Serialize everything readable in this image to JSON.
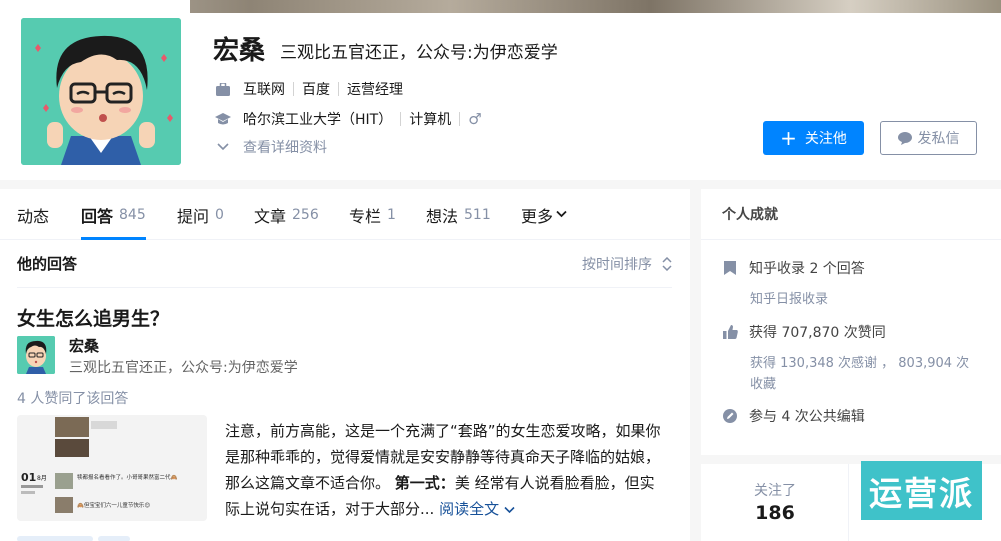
{
  "profile": {
    "name": "宏桑",
    "headline": "三观比五官还正，公众号:为伊恋爱学",
    "work": [
      "互联网",
      "百度",
      "运营经理"
    ],
    "education": [
      "哈尔滨工业大学（HIT）",
      "计算机"
    ],
    "gender_symbol": "♂",
    "more_details": "查看详细资料",
    "follow_label": "关注他",
    "message_label": "发私信"
  },
  "tabs": [
    {
      "label": "动态",
      "count": ""
    },
    {
      "label": "回答",
      "count": "845"
    },
    {
      "label": "提问",
      "count": "0"
    },
    {
      "label": "文章",
      "count": "256"
    },
    {
      "label": "专栏",
      "count": "1"
    },
    {
      "label": "想法",
      "count": "511"
    },
    {
      "label": "更多",
      "count": ""
    }
  ],
  "list": {
    "title": "他的回答",
    "sort": "按时间排序"
  },
  "answer": {
    "question": "女生怎么追男生？",
    "author": "宏桑",
    "author_bio": "三观比五官还正，公众号:为伊恋爱学",
    "votes": "4 人赞同了该回答",
    "excerpt_plain": "注意，前方高能，这是一个充满了“套路”的女生恋爱攻略，如果你是那种乖乖的，觉得爱情就是安安静静等待真命天子降临的姑娘，那么这篇文章不适合你。",
    "excerpt_bold": "第一式：",
    "excerpt_tail": "美 经常有人说看脸看脸，但实际上说句实在话，对于大部分...",
    "read_more": "阅读全文",
    "thumb_date": "01",
    "thumb_month": "8月",
    "thumb_line1": "犊都报名看看作了。小哥哥果然富二代🙈",
    "thumb_line2": "🙈但宝宝们六一儿童节快乐😊"
  },
  "achievements": {
    "title": "个人成就",
    "collected": "知乎收录 2 个回答",
    "daily": "知乎日报收录",
    "likes": "获得 707,870 次赞同",
    "thanks": "获得 130,348 次感谢 ， 803,904 次收藏",
    "edits": "参与 4 次公共编辑"
  },
  "follow": {
    "following_label": "关注了",
    "following_count": "186"
  },
  "watermark": "运营派",
  "colors": {
    "accent": "#0084ff",
    "muted": "#8590a6",
    "avatar_bg": "#56cbb0",
    "watermark_bg": "#3fc2c9"
  }
}
